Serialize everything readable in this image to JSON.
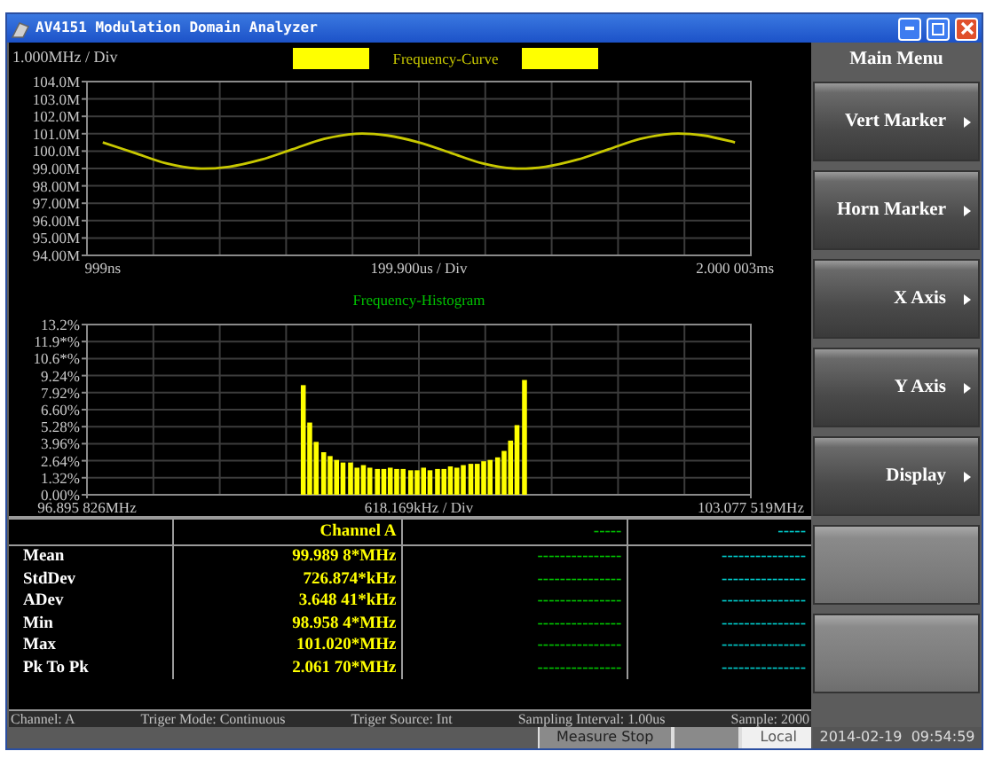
{
  "window": {
    "title": "AV4151 Modulation Domain Analyzer"
  },
  "curve_panel": {
    "chart_data": {
      "type": "line",
      "title": "Frequency-Curve",
      "ylabel": "1.000MHz / Div",
      "xlabel": "199.900us / Div",
      "categories": [
        "999ns",
        null,
        null,
        null,
        null,
        null,
        null,
        null,
        null,
        null,
        null,
        null,
        null,
        null,
        null,
        null,
        null,
        null,
        null,
        null,
        "2.000 003ms"
      ],
      "series": [
        {
          "color": "#c8c800",
          "values": [
            100.5,
            99.9,
            99.3,
            99.0,
            99.1,
            99.5,
            100.1,
            100.7,
            101.0,
            100.9,
            100.5,
            99.9,
            99.3,
            99.0,
            99.1,
            99.5,
            100.1,
            100.7,
            101.0,
            100.9,
            100.5
          ]
        }
      ],
      "ylim": [
        94,
        104
      ],
      "grid": true,
      "yticks": [
        {
          "value": 104,
          "label": "104.0M"
        },
        {
          "value": 103,
          "label": "103.0M"
        },
        {
          "value": 102,
          "label": "102.0M"
        },
        {
          "value": 101,
          "label": "101.0M"
        },
        {
          "value": 100,
          "label": "100.0M"
        },
        {
          "value": 99,
          "label": "99.00M"
        },
        {
          "value": 98,
          "label": "98.00M"
        },
        {
          "value": 97,
          "label": "97.00M"
        },
        {
          "value": 96,
          "label": "96.00M"
        },
        {
          "value": 95,
          "label": "95.00M"
        },
        {
          "value": 94,
          "label": "94.00M"
        }
      ]
    }
  },
  "histogram_panel": {
    "chart_data": {
      "type": "bar",
      "title": "Frequency-Histogram",
      "xlabel": "618.169kHz / Div",
      "x": [
        98.91,
        98.97,
        99.03,
        99.1,
        99.16,
        99.22,
        99.28,
        99.35,
        99.41,
        99.47,
        99.53,
        99.6,
        99.66,
        99.72,
        99.78,
        99.84,
        99.91,
        99.97,
        100.03,
        100.09,
        100.16,
        100.22,
        100.28,
        100.34,
        100.4,
        100.47,
        100.53,
        100.59,
        100.65,
        100.72,
        100.78,
        100.84,
        100.9,
        100.97
      ],
      "series": [
        {
          "color": "#ffff00",
          "values": [
            8.5,
            5.6,
            4.1,
            3.3,
            3.0,
            2.7,
            2.5,
            2.5,
            2.1,
            2.3,
            2.1,
            2.0,
            2.0,
            2.1,
            2.0,
            2.0,
            1.9,
            1.9,
            2.1,
            1.9,
            2.0,
            2.0,
            2.2,
            2.1,
            2.3,
            2.4,
            2.4,
            2.6,
            2.7,
            2.9,
            3.4,
            4.2,
            5.4,
            8.9
          ]
        }
      ],
      "xlim": [
        96.895826,
        103.077519
      ],
      "ylim": [
        0,
        13.2
      ],
      "grid": true,
      "xticks": [
        {
          "value": 96.895826,
          "label": "96.895 826MHz"
        },
        {
          "value": 103.077519,
          "label": "103.077 519MHz"
        }
      ],
      "yticks": [
        {
          "value": 13.2,
          "label": "13.2%"
        },
        {
          "value": 11.88,
          "label": "11.9*%"
        },
        {
          "value": 10.56,
          "label": "10.6*%"
        },
        {
          "value": 9.24,
          "label": "9.24%"
        },
        {
          "value": 7.92,
          "label": "7.92%"
        },
        {
          "value": 6.6,
          "label": "6.60%"
        },
        {
          "value": 5.28,
          "label": "5.28%"
        },
        {
          "value": 3.96,
          "label": "3.96%"
        },
        {
          "value": 2.64,
          "label": "2.64%"
        },
        {
          "value": 1.32,
          "label": "1.32%"
        },
        {
          "value": 0,
          "label": "0.00%"
        }
      ]
    }
  },
  "measurements": {
    "columns": [
      {
        "header": "Channel A",
        "color": "#ffff00"
      },
      {
        "header": "-----",
        "color": "#00c000"
      },
      {
        "header": "-----",
        "color": "#00c8c8"
      }
    ],
    "rows": [
      {
        "label": "Mean",
        "values": [
          "99.989 8*MHz",
          "---------------",
          "---------------"
        ]
      },
      {
        "label": "StdDev",
        "values": [
          "726.874*kHz",
          "---------------",
          "---------------"
        ]
      },
      {
        "label": "ADev",
        "values": [
          "3.648 41*kHz",
          "---------------",
          "---------------"
        ]
      },
      {
        "label": "Min",
        "values": [
          "98.958 4*MHz",
          "---------------",
          "---------------"
        ]
      },
      {
        "label": "Max",
        "values": [
          "101.020*MHz",
          "---------------",
          "---------------"
        ]
      },
      {
        "label": "Pk To Pk",
        "values": [
          "2.061 70*MHz",
          "---------------",
          "---------------"
        ]
      }
    ]
  },
  "status_line": [
    "Channel: A",
    "Triger Mode: Continuous",
    "Triger Source: Int",
    "Sampling Interval: 1.00us",
    "Sample: 2000"
  ],
  "status_bar": {
    "state": "Measure Stop",
    "mode": "Local",
    "datetime": "2014-02-19  09:54:59"
  },
  "menu": {
    "title": "Main Menu",
    "buttons": [
      {
        "kind": "submenu",
        "label": "Vert Marker"
      },
      {
        "kind": "submenu",
        "label": "Horn Marker"
      },
      {
        "kind": "submenu",
        "label": "X Axis"
      },
      {
        "kind": "submenu",
        "label": "Y Axis"
      },
      {
        "kind": "submenu",
        "label": "Display"
      },
      {
        "kind": "blank"
      },
      {
        "kind": "blank"
      }
    ]
  }
}
